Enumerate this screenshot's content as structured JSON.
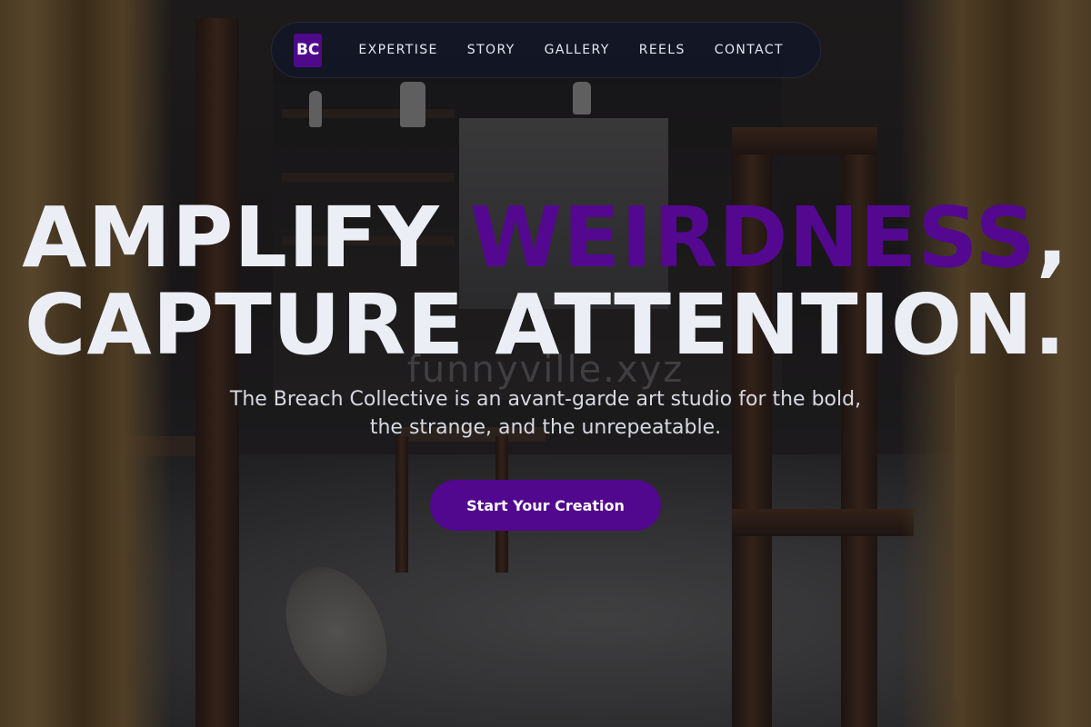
{
  "nav": {
    "logo": "BC",
    "links": [
      "EXPERTISE",
      "STORY",
      "GALLERY",
      "REELS",
      "CONTACT"
    ]
  },
  "hero": {
    "headline_part1": "AMPLIFY ",
    "headline_accent": "WEIRDNESS",
    "headline_part2": ",",
    "headline_line2": "CAPTURE ATTENTION.",
    "watermark": "funnyville.xyz",
    "subtitle": "The Breach Collective is an avant-garde art studio for the bold, the strange, and the unrepeatable.",
    "cta_label": "Start Your Creation"
  },
  "colors": {
    "accent": "#53088f",
    "nav_background": "#121626",
    "headline": "#eceef6"
  }
}
